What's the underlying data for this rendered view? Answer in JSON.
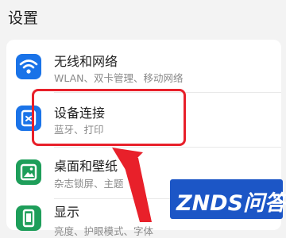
{
  "header": {
    "title": "设置"
  },
  "settings": {
    "items": [
      {
        "title": "无线和网络",
        "subtitle": "WLAN、双卡管理、移动网络",
        "icon": "wifi-icon",
        "color": "#1a73e8"
      },
      {
        "title": "设备连接",
        "subtitle": "蓝牙、打印",
        "icon": "device-connection-icon",
        "color": "#1a73e8"
      },
      {
        "title": "桌面和壁纸",
        "subtitle": "杂志锁屏、主题",
        "icon": "wallpaper-icon",
        "color": "#1e9e5a"
      },
      {
        "title": "显示",
        "subtitle": "亮度、护眼模式、字体",
        "icon": "display-icon",
        "color": "#1e9e5a"
      }
    ]
  },
  "annotation": {
    "highlight_color": "#e8202a"
  },
  "watermark": {
    "text": "ZNDS问答",
    "color": "#1c56c6"
  }
}
